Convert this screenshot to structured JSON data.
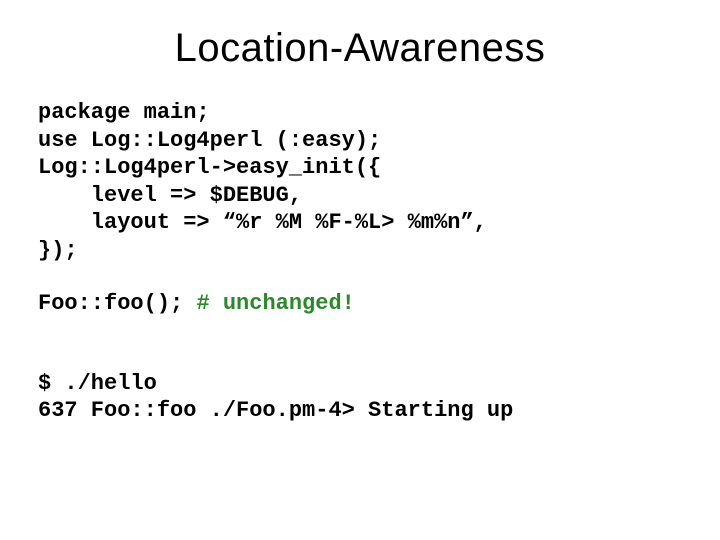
{
  "title": "Location-Awareness",
  "code": {
    "l1": "package main;",
    "l2": "use Log::Log4perl (:easy);",
    "l3": "Log::Log4perl->easy_init({",
    "l4": "    level => $DEBUG,",
    "l5": "    layout => “%r %M %F-%L> %m%n”,",
    "l6": "});",
    "call": "Foo::foo(); ",
    "comment": "# unchanged!",
    "run": "$ ./hello",
    "out": "637 Foo::foo ./Foo.pm-4> Starting up"
  }
}
